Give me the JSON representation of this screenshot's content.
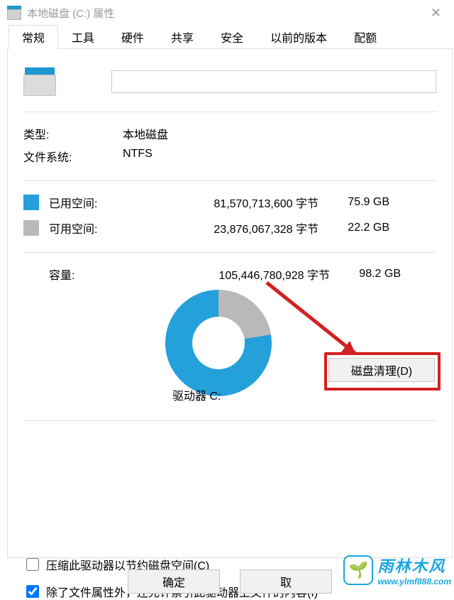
{
  "window": {
    "title": "本地磁盘 (C:) 属性",
    "close_icon": "✕"
  },
  "tabs": [
    "常规",
    "工具",
    "硬件",
    "共享",
    "安全",
    "以前的版本",
    "配额"
  ],
  "active_tab_index": 0,
  "info": {
    "type_label": "类型:",
    "type_value": "本地磁盘",
    "fs_label": "文件系统:",
    "fs_value": "NTFS"
  },
  "space": {
    "used_label": "已用空间:",
    "used_bytes": "81,570,713,600 字节",
    "used_gb": "75.9 GB",
    "free_label": "可用空间:",
    "free_bytes": "23,876,067,328 字节",
    "free_gb": "22.2 GB",
    "capacity_label": "容量:",
    "capacity_bytes": "105,446,780,928 字节",
    "capacity_gb": "98.2 GB"
  },
  "drive_label": "驱动器 C:",
  "buttons": {
    "cleanup": "磁盘清理(D)",
    "ok": "确定",
    "cancel": "取"
  },
  "checks": {
    "compress_label": "压缩此驱动器以节约磁盘空间(C)",
    "compress_checked": false,
    "index_label": "除了文件属性外，还允许索引此驱动器上文件的内容(I)",
    "index_checked": true
  },
  "watermark": {
    "brand": "雨林木风",
    "url": "www.ylmf888.com",
    "leaf": "🌱"
  }
}
